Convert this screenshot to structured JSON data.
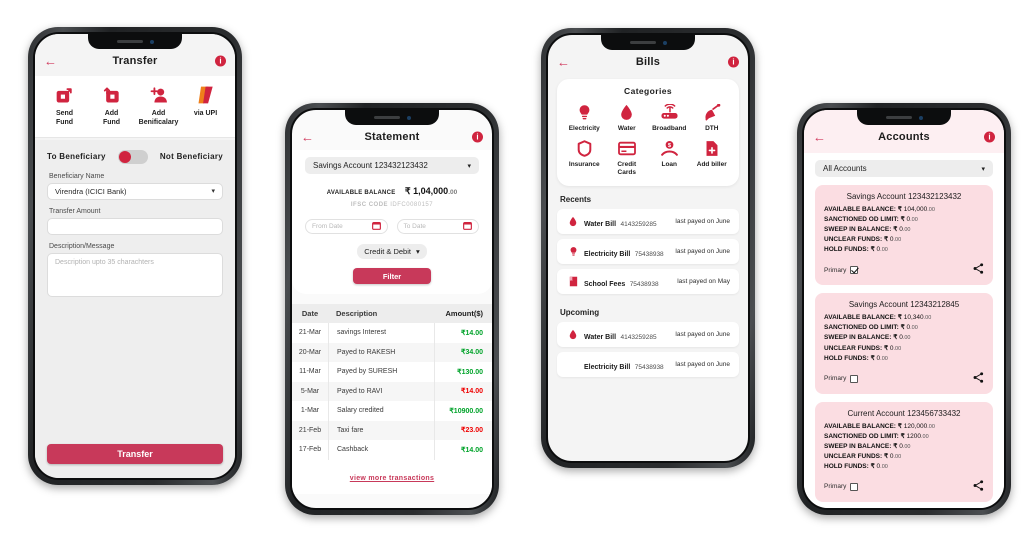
{
  "accent": "#c8395a",
  "badge_red": "#d0243f",
  "credit_green": "#00a32a",
  "debit_red": "#ef0000",
  "card_pink": "#fbdde2",
  "transfer": {
    "title": "Transfer",
    "back_icon": "back-arrow-icon",
    "info_icon": "info-icon",
    "info_label": "i",
    "quick_actions": [
      {
        "label": "Send\nFund",
        "line1": "Send",
        "line2": "Fund",
        "icon": "send-fund-icon"
      },
      {
        "label": "Add\nFund",
        "line1": "Add",
        "line2": "Fund",
        "icon": "add-fund-icon"
      },
      {
        "label": "Add\nBenificalary",
        "line1": "Add",
        "line2": "Benificalary",
        "icon": "add-beneficiary-icon"
      },
      {
        "label": "via UPI",
        "line1": "via UPI",
        "line2": "",
        "icon": "upi-icon"
      }
    ],
    "toggle_left_label": "To Beneficiary",
    "toggle_right_label": "Not Beneficiary",
    "toggle_state": "left",
    "beneficiary_label": "Beneficiary Name",
    "beneficiary_value": "Virendra (ICICI Bank)",
    "amount_label": "Transfer Amount",
    "amount_value": "",
    "description_label": "Description/Message",
    "description_placeholder": "Description upto 35 charachters",
    "submit_label": "Transfer"
  },
  "statement": {
    "title": "Statement",
    "info_label": "i",
    "account_select": "Savings Account 123432123432",
    "balance_label": "AVAILABLE BALANCE",
    "balance_main": "₹ 1,04,000",
    "balance_cents": ".00",
    "ifsc_label": "IFSC CODE",
    "ifsc_value": "IDFC0080157",
    "from_date_placeholder": "From Date",
    "to_date_placeholder": "To Date",
    "type_select": "Credit & Debit",
    "filter_label": "Filter",
    "columns": [
      "Date",
      "Description",
      "Amount($)"
    ],
    "rows": [
      {
        "date": "21-Mar",
        "desc": "savings Interest",
        "amount": "₹14.00",
        "kind": "credit"
      },
      {
        "date": "20-Mar",
        "desc": "Payed to RAKESH",
        "amount": "₹34.00",
        "kind": "credit"
      },
      {
        "date": "11-Mar",
        "desc": "Payed by SURESH",
        "amount": "₹130.00",
        "kind": "credit"
      },
      {
        "date": "5-Mar",
        "desc": "Payed to RAVI",
        "amount": "₹14.00",
        "kind": "debit"
      },
      {
        "date": "1-Mar",
        "desc": "Salary credited",
        "amount": "₹10900.00",
        "kind": "credit"
      },
      {
        "date": "21-Feb",
        "desc": "Taxi fare",
        "amount": "₹23.00",
        "kind": "debit"
      },
      {
        "date": "17-Feb",
        "desc": "Cashback",
        "amount": "₹14.00",
        "kind": "credit"
      }
    ],
    "view_more": "view more transactions"
  },
  "bills": {
    "title": "Bills",
    "info_label": "i",
    "categories_title": "Categories",
    "categories": [
      {
        "label": "Electricity",
        "icon": "bulb-icon"
      },
      {
        "label": "Water",
        "icon": "water-drop-icon"
      },
      {
        "label": "Broadband",
        "icon": "router-icon"
      },
      {
        "label": "DTH",
        "icon": "satellite-dish-icon"
      },
      {
        "label": "Insurance",
        "icon": "shield-icon"
      },
      {
        "label": "Credit Cards",
        "line1": "Credit",
        "line2": "Cards",
        "icon": "credit-card-icon"
      },
      {
        "label": "Loan",
        "icon": "hand-money-icon"
      },
      {
        "label": "Add biller",
        "icon": "add-document-icon"
      }
    ],
    "recents_title": "Recents",
    "recents": [
      {
        "name": "Water Bill",
        "number": "4143259285",
        "when": "last payed on June",
        "icon": "water-drop-icon"
      },
      {
        "name": "Electricity Bill",
        "number": "75438938",
        "when": "last payed on June",
        "icon": "bulb-icon"
      },
      {
        "name": "School Fees",
        "number": "75438938",
        "when": "last payed on May",
        "icon": "book-icon"
      }
    ],
    "upcoming_title": "Upcoming",
    "upcoming": [
      {
        "name": "Water Bill",
        "number": "4143259285",
        "when": "last payed on June",
        "icon": "water-drop-icon"
      },
      {
        "name": "Electricity Bill",
        "number": "75438938",
        "when": "last payed on June",
        "icon": "none"
      }
    ]
  },
  "accounts": {
    "title": "Accounts",
    "info_label": "i",
    "filter_select": "All Accounts",
    "primary_label": "Primary",
    "share_icon": "share-icon",
    "cards": [
      {
        "title": "Savings Account 123432123432",
        "primary": true,
        "rows": [
          {
            "k": "AVAILABLE BALANCE:",
            "sym": "₹",
            "v": "104,000",
            "c": ".00"
          },
          {
            "k": "SANCTIONED OD LIMIT:",
            "sym": "₹",
            "v": "0",
            "c": ".00"
          },
          {
            "k": "SWEEP IN BALANCE:",
            "sym": "₹",
            "v": "0",
            "c": ".00"
          },
          {
            "k": "UNCLEAR FUNDS:",
            "sym": "₹",
            "v": "0",
            "c": ".00"
          },
          {
            "k": "HOLD FUNDS:",
            "sym": "₹",
            "v": "0",
            "c": ".00"
          }
        ]
      },
      {
        "title": "Savings Account 12343212845",
        "primary": false,
        "rows": [
          {
            "k": "AVAILABLE BALANCE:",
            "sym": "₹",
            "v": "10,340",
            "c": ".00"
          },
          {
            "k": "SANCTIONED OD LIMIT:",
            "sym": "₹",
            "v": "0",
            "c": ".00"
          },
          {
            "k": "SWEEP IN BALANCE:",
            "sym": "₹",
            "v": "0",
            "c": ".00"
          },
          {
            "k": "UNCLEAR FUNDS:",
            "sym": "₹",
            "v": "0",
            "c": ".00"
          },
          {
            "k": "HOLD FUNDS:",
            "sym": "₹",
            "v": "0",
            "c": ".00"
          }
        ]
      },
      {
        "title": "Current Account 123456733432",
        "primary": false,
        "rows": [
          {
            "k": "AVAILABLE BALANCE:",
            "sym": "₹",
            "v": "120,000",
            "c": ".00"
          },
          {
            "k": "SANCTIONED OD LIMIT:",
            "sym": "₹",
            "v": "1200",
            "c": ".00"
          },
          {
            "k": "SWEEP IN BALANCE:",
            "sym": "₹",
            "v": "0",
            "c": ".00"
          },
          {
            "k": "UNCLEAR FUNDS:",
            "sym": "₹",
            "v": "0",
            "c": ".00"
          },
          {
            "k": "HOLD FUNDS:",
            "sym": "₹",
            "v": "0",
            "c": ".00"
          }
        ]
      }
    ]
  }
}
